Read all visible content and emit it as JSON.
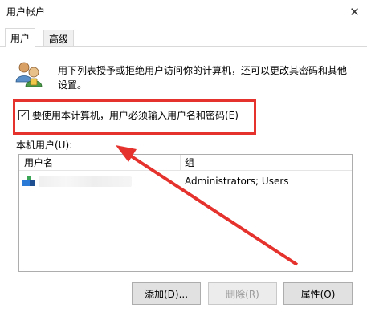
{
  "window": {
    "title": "用户帐户"
  },
  "tabs": [
    {
      "label": "用户",
      "active": true
    },
    {
      "label": "高级",
      "active": false
    }
  ],
  "description": "用下列表授予或拒绝用户访问你的计算机，还可以更改其密码和其他设置。",
  "checkbox": {
    "label": "要使用本计算机，用户必须输入用户名和密码(E)",
    "checked": true
  },
  "group_label": "本机用户(U):",
  "list": {
    "columns": [
      "用户名",
      "组"
    ],
    "rows": [
      {
        "name": "",
        "group": "Administrators; Users"
      }
    ]
  },
  "buttons": {
    "add": "添加(D)...",
    "delete": "删除(R)",
    "properties": "属性(O)"
  },
  "colors": {
    "annotation": "#e5322d"
  }
}
